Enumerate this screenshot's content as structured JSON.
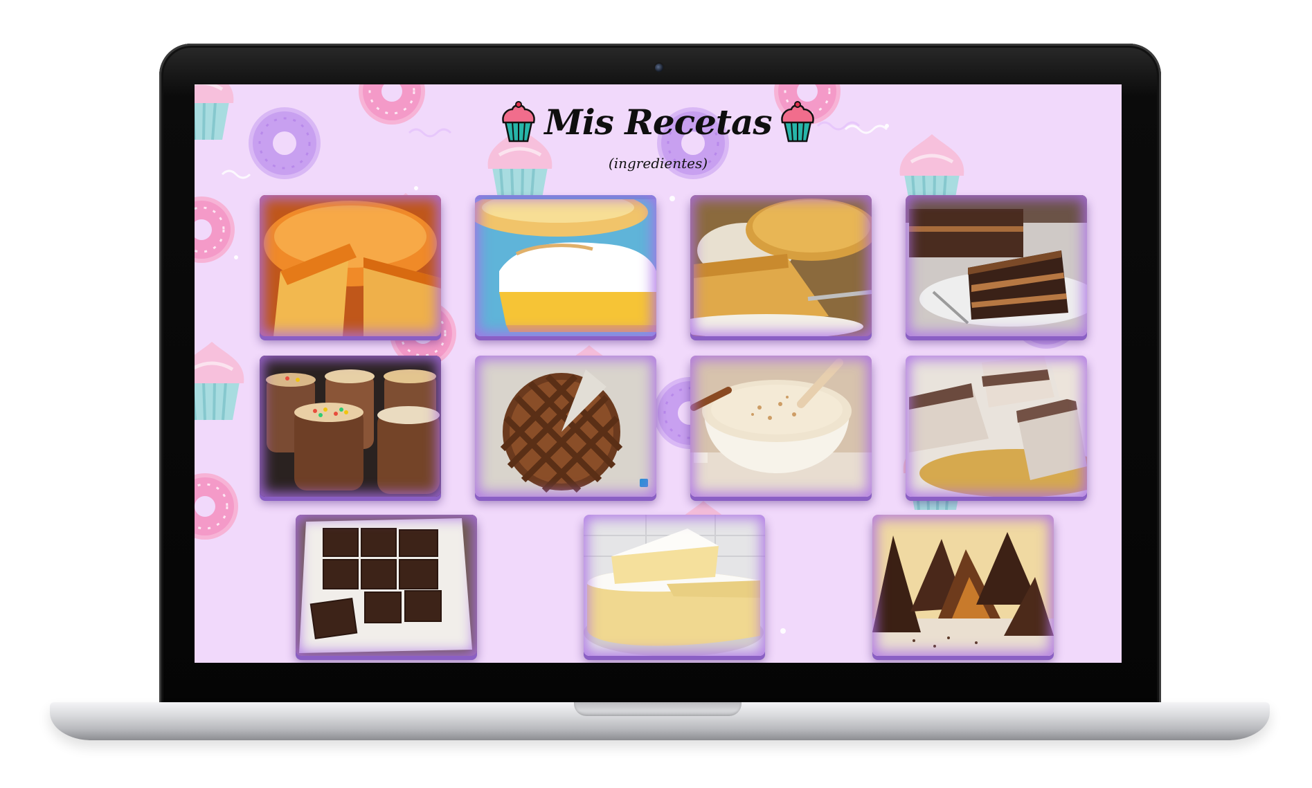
{
  "header": {
    "title": "Mis Recetas",
    "subtitle": "(ingredientes)",
    "left_icon": "cupcake-icon",
    "right_icon": "cupcake-icon"
  },
  "colors": {
    "screen_background": "#f1d9fb",
    "card_glow": "#b07fe0",
    "title_text": "#0f0f0f"
  },
  "recipes": [
    {
      "row": 1,
      "image": "flan"
    },
    {
      "row": 1,
      "image": "lemon-meringue-pie"
    },
    {
      "row": 1,
      "image": "apple-crumble-tart"
    },
    {
      "row": 1,
      "image": "chocolate-layer-cake"
    },
    {
      "row": 2,
      "image": "chocolate-pudding-cups"
    },
    {
      "row": 2,
      "image": "lattice-tart"
    },
    {
      "row": 2,
      "image": "rice-pudding"
    },
    {
      "row": 2,
      "image": "chocolate-marshmallow-bars"
    },
    {
      "row": 3,
      "image": "brownies"
    },
    {
      "row": 3,
      "image": "cheese-cake"
    },
    {
      "row": 3,
      "image": "chocolate-cones"
    }
  ]
}
